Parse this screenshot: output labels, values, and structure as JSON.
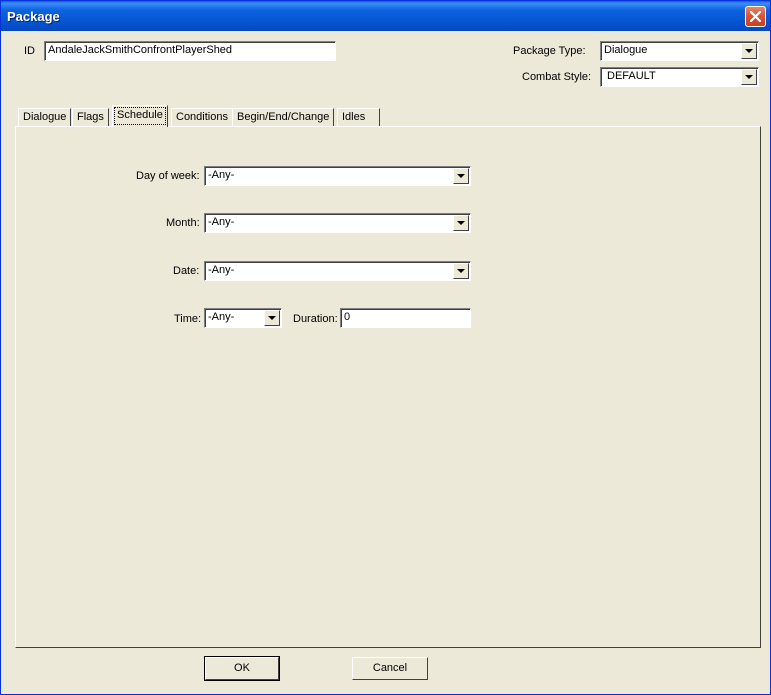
{
  "window": {
    "title": "Package"
  },
  "id_field": {
    "label": "ID",
    "value": "AndaleJackSmithConfrontPlayerShed"
  },
  "package_type": {
    "label": "Package Type:",
    "value": "Dialogue"
  },
  "combat_style": {
    "label": "Combat Style:",
    "value": "DEFAULT"
  },
  "tabs": [
    {
      "label": "Dialogue"
    },
    {
      "label": "Flags"
    },
    {
      "label": "Schedule"
    },
    {
      "label": "Conditions"
    },
    {
      "label": "Begin/End/Change"
    },
    {
      "label": "Idles"
    }
  ],
  "active_tab": "Schedule",
  "schedule": {
    "day_of_week": {
      "label": "Day of week:",
      "value": "-Any-"
    },
    "month": {
      "label": "Month:",
      "value": "-Any-"
    },
    "date": {
      "label": "Date:",
      "value": "-Any-"
    },
    "time": {
      "label": "Time:",
      "value": "-Any-"
    },
    "duration": {
      "label": "Duration:",
      "value": "0"
    }
  },
  "buttons": {
    "ok": "OK",
    "cancel": "Cancel"
  },
  "colors": {
    "titlebar": "#0654d0",
    "dialog_bg": "#ece9d8",
    "close": "#d9553a"
  }
}
